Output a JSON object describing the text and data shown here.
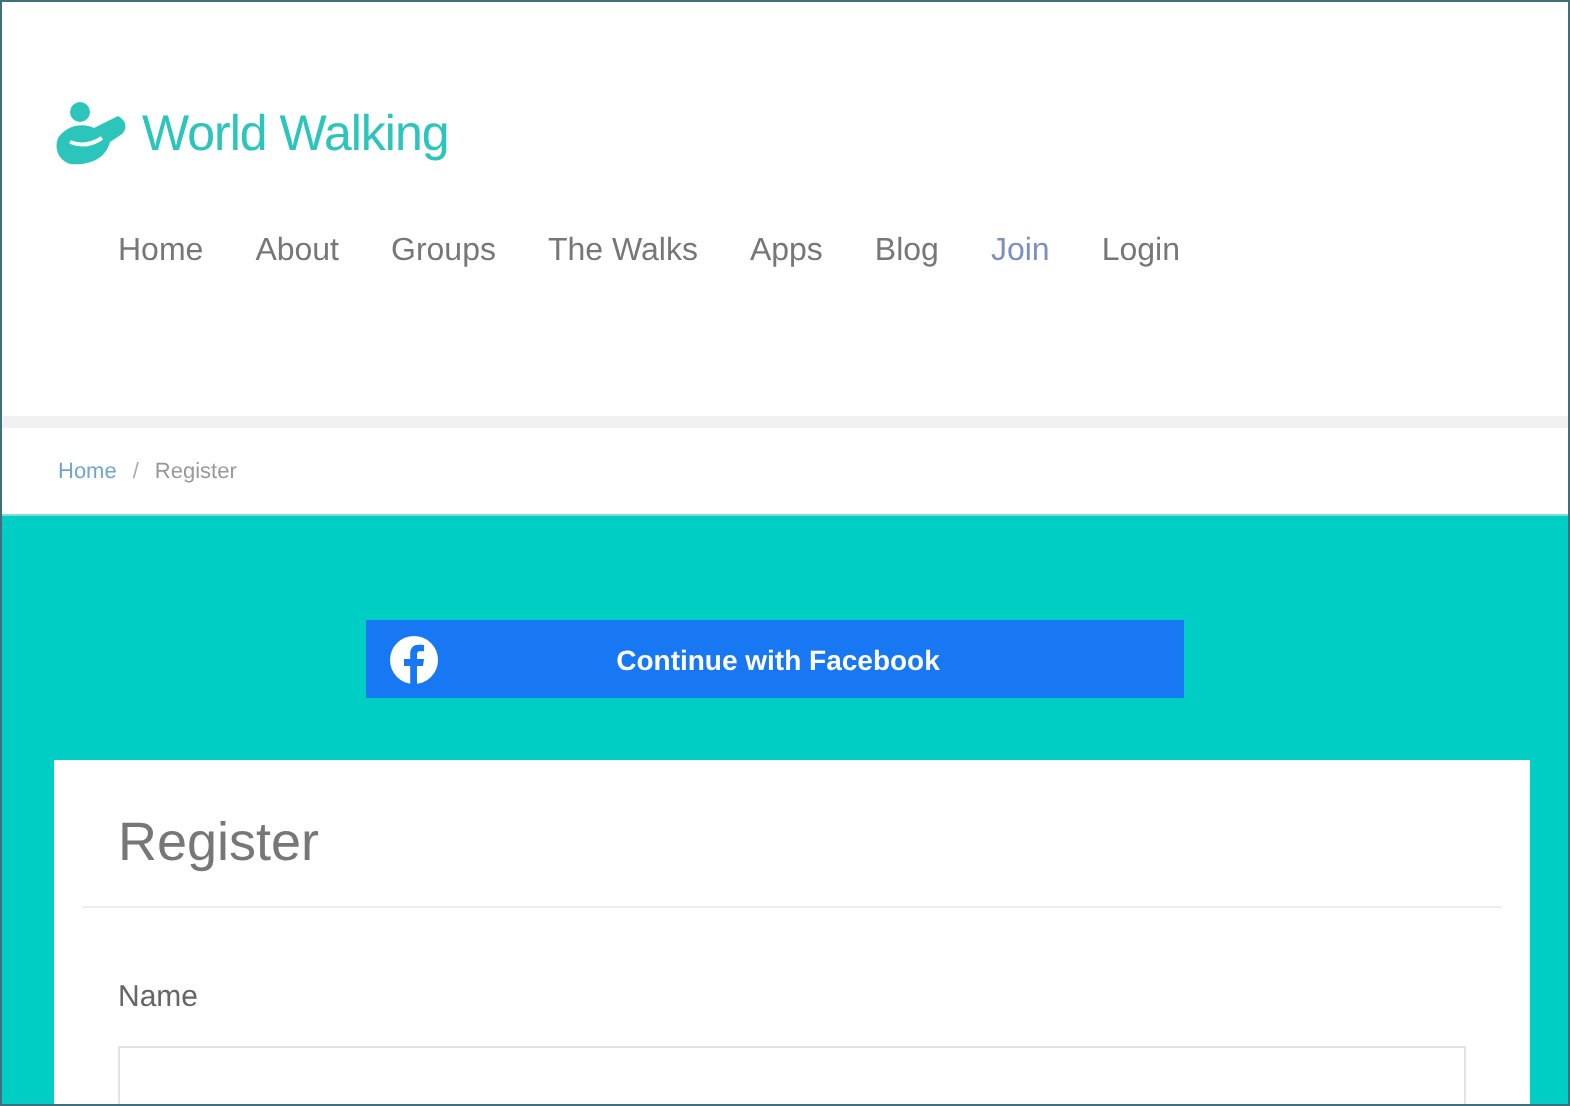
{
  "logo": {
    "text": "World Walking"
  },
  "nav": [
    {
      "label": "Home",
      "selected": false
    },
    {
      "label": "About",
      "selected": false
    },
    {
      "label": "Groups",
      "selected": false
    },
    {
      "label": "The Walks",
      "selected": false
    },
    {
      "label": "Apps",
      "selected": false
    },
    {
      "label": "Blog",
      "selected": false
    },
    {
      "label": "Join",
      "selected": true
    },
    {
      "label": "Login",
      "selected": false
    }
  ],
  "breadcrumb": [
    {
      "label": "Home",
      "kind": "link"
    },
    {
      "label": "/",
      "kind": "separator"
    },
    {
      "label": "Register",
      "kind": "current"
    }
  ],
  "facebook_button": {
    "label": "Continue with Facebook"
  },
  "form": {
    "title": "Register",
    "fields": [
      {
        "label": "Name"
      }
    ]
  }
}
